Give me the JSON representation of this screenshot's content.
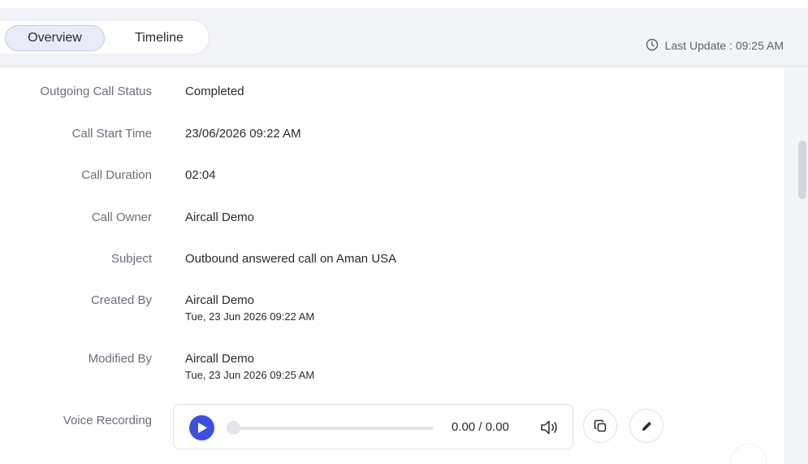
{
  "tabs": [
    {
      "label": "Overview",
      "active": true
    },
    {
      "label": "Timeline",
      "active": false
    }
  ],
  "last_update": {
    "text": "Last Update : 09:25 AM",
    "icon": "clock-icon"
  },
  "fields": {
    "outgoing_call_status": {
      "label": "Outgoing Call Status",
      "value": "Completed"
    },
    "call_start_time": {
      "label": "Call Start Time",
      "value": "23/06/2026 09:22 AM"
    },
    "call_duration": {
      "label": "Call Duration",
      "value": "02:04"
    },
    "call_owner": {
      "label": "Call Owner",
      "value": "Aircall Demo"
    },
    "subject": {
      "label": "Subject",
      "value": "Outbound answered call on Aman USA"
    },
    "created_by": {
      "label": "Created By",
      "value": "Aircall Demo",
      "timestamp": "Tue, 23 Jun 2026 09:22 AM"
    },
    "modified_by": {
      "label": "Modified By",
      "value": "Aircall Demo",
      "timestamp": "Tue, 23 Jun 2026 09:25 AM"
    },
    "voice_recording": {
      "label": "Voice Recording"
    }
  },
  "player": {
    "time": "0.00 / 0.00",
    "progress": 0,
    "play_icon": "play-icon",
    "volume_icon": "volume-icon"
  },
  "actions": {
    "copy_icon": "copy-icon",
    "edit_icon": "pencil-icon"
  },
  "colors": {
    "accent": "#3e4fe0",
    "active_tab_bg": "#e9ebf7",
    "header_bg": "#f3f4f7"
  }
}
